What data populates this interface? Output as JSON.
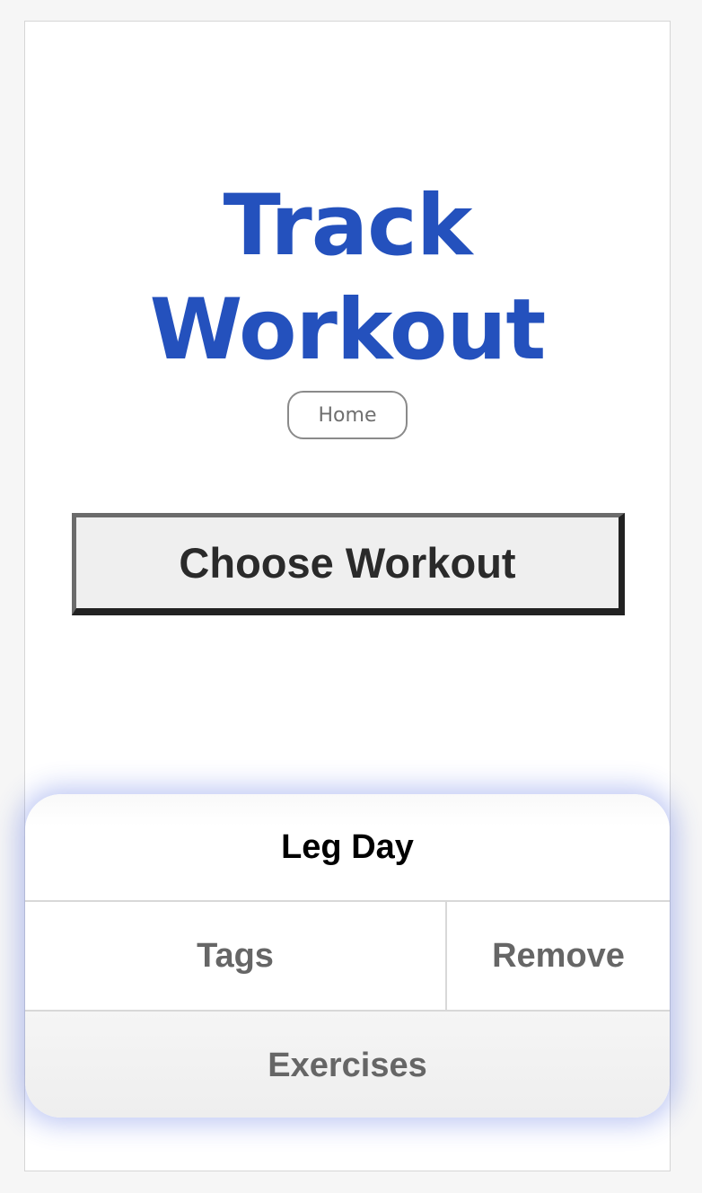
{
  "page": {
    "title_line1": "Track",
    "title_line2": "Workout",
    "home_label": "Home",
    "choose_label": "Choose Workout"
  },
  "workout_card": {
    "name": "Leg Day",
    "tags_label": "Tags",
    "remove_label": "Remove",
    "exercises_label": "Exercises"
  },
  "colors": {
    "title": "#2451bd",
    "card_glow": "#3250dc"
  }
}
